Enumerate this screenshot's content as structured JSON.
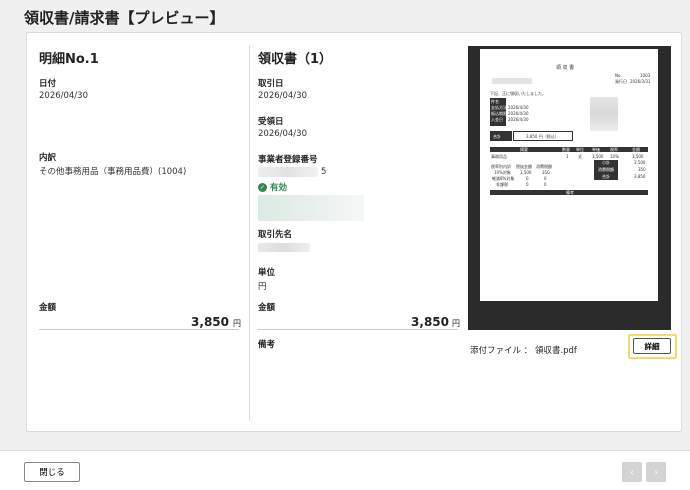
{
  "header": {
    "title": "領収書/請求書【プレビュー】"
  },
  "detail": {
    "heading": "明細No.1",
    "date_label": "日付",
    "date_value": "2026/04/30",
    "desc_label": "内訳",
    "desc_value": "その他事務用品（事務用品費）(1004)",
    "amount_label": "金額",
    "amount_value": "3,850",
    "currency": "円"
  },
  "receipt": {
    "heading": "領収書（1）",
    "txn_date_label": "取引日",
    "txn_date_value": "2026/04/30",
    "recv_date_label": "受領日",
    "recv_date_value": "2026/04/30",
    "reg_no_label": "事業者登録番号",
    "reg_no_suffix": "5",
    "valid_label": "有効",
    "partner_label": "取引先名",
    "unit_label": "単位",
    "unit_value": "円",
    "amount_label": "金額",
    "amount_value": "3,850",
    "currency": "円",
    "memo_label": "備考"
  },
  "preview": {
    "doc_title": "領 収 書",
    "thanks_text": "下記、正に領収いたしました。",
    "total_label": "合計",
    "total_value": "3,850 円（税込）",
    "no_label": "No.",
    "no_value": "1003",
    "issue_label": "発行日",
    "issue_value": "2026/3/31",
    "table_headers": [
      "摘要",
      "数量",
      "単位",
      "単価",
      "税率",
      "金額"
    ],
    "row1": [
      "事務用品",
      "1",
      "式",
      "3,500",
      "10%",
      "3,500"
    ],
    "subtotal_label": "小計",
    "subtotal_value": "3,500",
    "tax_label": "消費税額",
    "tax_value": "350",
    "sum_label": "合計",
    "sum_value": "3,850",
    "tax_headers": [
      "税率別内訳",
      "税抜金額",
      "消費税額"
    ],
    "tax_rows": [
      [
        "10%対象",
        "3,500",
        "350"
      ],
      [
        "軽減8%対象",
        "0",
        "0"
      ],
      [
        "非課税",
        "0",
        "0"
      ]
    ],
    "note_label": "備考",
    "left_info": [
      "件名",
      "支払方法",
      "振込期限",
      "入金日"
    ],
    "left_dates": [
      "2026/4/30",
      "2026/4/30",
      "2026/4/30"
    ]
  },
  "attachment": {
    "label": "添付ファイル",
    "separator": "：",
    "filename": "領収書.pdf",
    "detail_button": "詳細"
  },
  "footer": {
    "close_button": "閉じる",
    "prev_icon": "‹",
    "next_icon": "›"
  },
  "colors": {
    "valid_green": "#2d8a4e",
    "highlight": "#f2d96a"
  }
}
